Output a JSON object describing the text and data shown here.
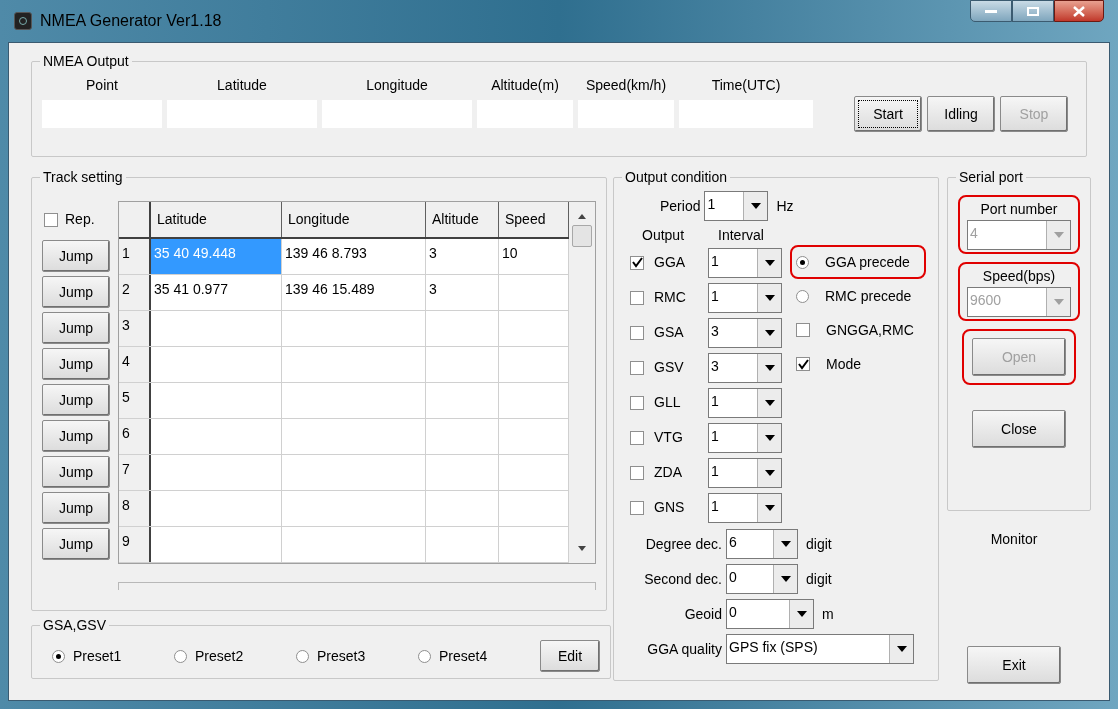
{
  "window": {
    "title": "NMEA Generator Ver1.18"
  },
  "nmea_output": {
    "title": "NMEA Output",
    "fields": [
      {
        "label": "Point"
      },
      {
        "label": "Latitude"
      },
      {
        "label": "Longitude"
      },
      {
        "label": "Altitude(m)"
      },
      {
        "label": "Speed(km/h)"
      },
      {
        "label": "Time(UTC)"
      }
    ],
    "buttons": [
      {
        "label": "Start",
        "disabled": false,
        "focused": true
      },
      {
        "label": "Idling",
        "disabled": false,
        "focused": false
      },
      {
        "label": "Stop",
        "disabled": true,
        "focused": false
      }
    ]
  },
  "track_setting": {
    "title": "Track setting",
    "repeat": {
      "label": "Rep.",
      "checked": false
    },
    "columns": [
      "Latitude",
      "Longitude",
      "Altitude",
      "Speed"
    ],
    "rows": [
      {
        "jump": "Jump",
        "number": "1",
        "cells": [
          {
            "text": "35 40 49.448",
            "selected": true
          },
          {
            "text": "139 46 8.793",
            "selected": false
          },
          {
            "text": "3",
            "selected": false
          },
          {
            "text": "10",
            "selected": false
          }
        ]
      },
      {
        "jump": "Jump",
        "number": "2",
        "cells": [
          {
            "text": "35 41 0.977",
            "selected": false
          },
          {
            "text": "139 46 15.489",
            "selected": false
          },
          {
            "text": "3",
            "selected": false
          },
          {
            "selected": false
          }
        ]
      },
      {
        "jump": "Jump",
        "number": "3",
        "cells": [
          {
            "selected": false
          },
          {
            "selected": false
          },
          {
            "selected": false
          },
          {
            "selected": false
          }
        ]
      },
      {
        "jump": "Jump",
        "number": "4",
        "cells": [
          {
            "selected": false
          },
          {
            "selected": false
          },
          {
            "selected": false
          },
          {
            "selected": false
          }
        ]
      },
      {
        "jump": "Jump",
        "number": "5",
        "cells": [
          {
            "selected": false
          },
          {
            "selected": false
          },
          {
            "selected": false
          },
          {
            "selected": false
          }
        ]
      },
      {
        "jump": "Jump",
        "number": "6",
        "cells": [
          {
            "selected": false
          },
          {
            "selected": false
          },
          {
            "selected": false
          },
          {
            "selected": false
          }
        ]
      },
      {
        "jump": "Jump",
        "number": "7",
        "cells": [
          {
            "selected": false
          },
          {
            "selected": false
          },
          {
            "selected": false
          },
          {
            "selected": false
          }
        ]
      },
      {
        "jump": "Jump",
        "number": "8",
        "cells": [
          {
            "selected": false
          },
          {
            "selected": false
          },
          {
            "selected": false
          },
          {
            "selected": false
          }
        ]
      },
      {
        "jump": "Jump",
        "number": "9",
        "cells": [
          {
            "selected": false
          },
          {
            "selected": false
          },
          {
            "selected": false
          },
          {
            "selected": false
          }
        ]
      }
    ]
  },
  "gsa_gsv": {
    "title": "GSA,GSV",
    "presets": [
      {
        "label": "Preset1",
        "selected": true
      },
      {
        "label": "Preset2",
        "selected": false
      },
      {
        "label": "Preset3",
        "selected": false
      },
      {
        "label": "Preset4",
        "selected": false
      }
    ],
    "edit": "Edit"
  },
  "output_condition": {
    "title": "Output condition",
    "period": {
      "label": "Period",
      "value": "1",
      "unit": "Hz"
    },
    "output_header": "Output",
    "interval_header": "Interval",
    "outputs": [
      {
        "label": "GGA",
        "checked": true,
        "interval": "1"
      },
      {
        "label": "RMC",
        "checked": false,
        "interval": "1"
      },
      {
        "label": "GSA",
        "checked": false,
        "interval": "3"
      },
      {
        "label": "GSV",
        "checked": false,
        "interval": "3"
      },
      {
        "label": "GLL",
        "checked": false,
        "interval": "1"
      },
      {
        "label": "VTG",
        "checked": false,
        "interval": "1"
      },
      {
        "label": "ZDA",
        "checked": false,
        "interval": "1"
      },
      {
        "label": "GNS",
        "checked": false,
        "interval": "1"
      }
    ],
    "options": [
      {
        "kind": "radio",
        "label": "GGA precede",
        "selected": true,
        "highlighted": true
      },
      {
        "kind": "radio",
        "label": "RMC precede",
        "selected": false,
        "highlighted": false
      },
      {
        "kind": "checkbox",
        "label": "GNGGA,RMC",
        "checked": false,
        "highlighted": false
      },
      {
        "kind": "checkbox",
        "label": "Mode",
        "checked": true,
        "highlighted": false
      }
    ],
    "settings": [
      {
        "label": "Degree dec.",
        "value": "6",
        "unit": "digit"
      },
      {
        "label": "Second dec.",
        "value": "0",
        "unit": "digit"
      },
      {
        "label": "Geoid",
        "value": "0",
        "unit": "m"
      },
      {
        "label": "GGA quality",
        "value": "GPS fix (SPS)"
      }
    ]
  },
  "serial_port": {
    "title": "Serial port",
    "selects": [
      {
        "label": "Port number",
        "value": "4",
        "disabled": true,
        "highlighted": true
      },
      {
        "label": "Speed(bps)",
        "value": "9600",
        "disabled": true,
        "highlighted": true
      }
    ],
    "buttons": [
      {
        "label": "Open",
        "disabled": true,
        "highlighted": true
      },
      {
        "label": "Close",
        "disabled": false,
        "highlighted": false
      }
    ]
  },
  "monitor": "Monitor",
  "exit": "Exit"
}
